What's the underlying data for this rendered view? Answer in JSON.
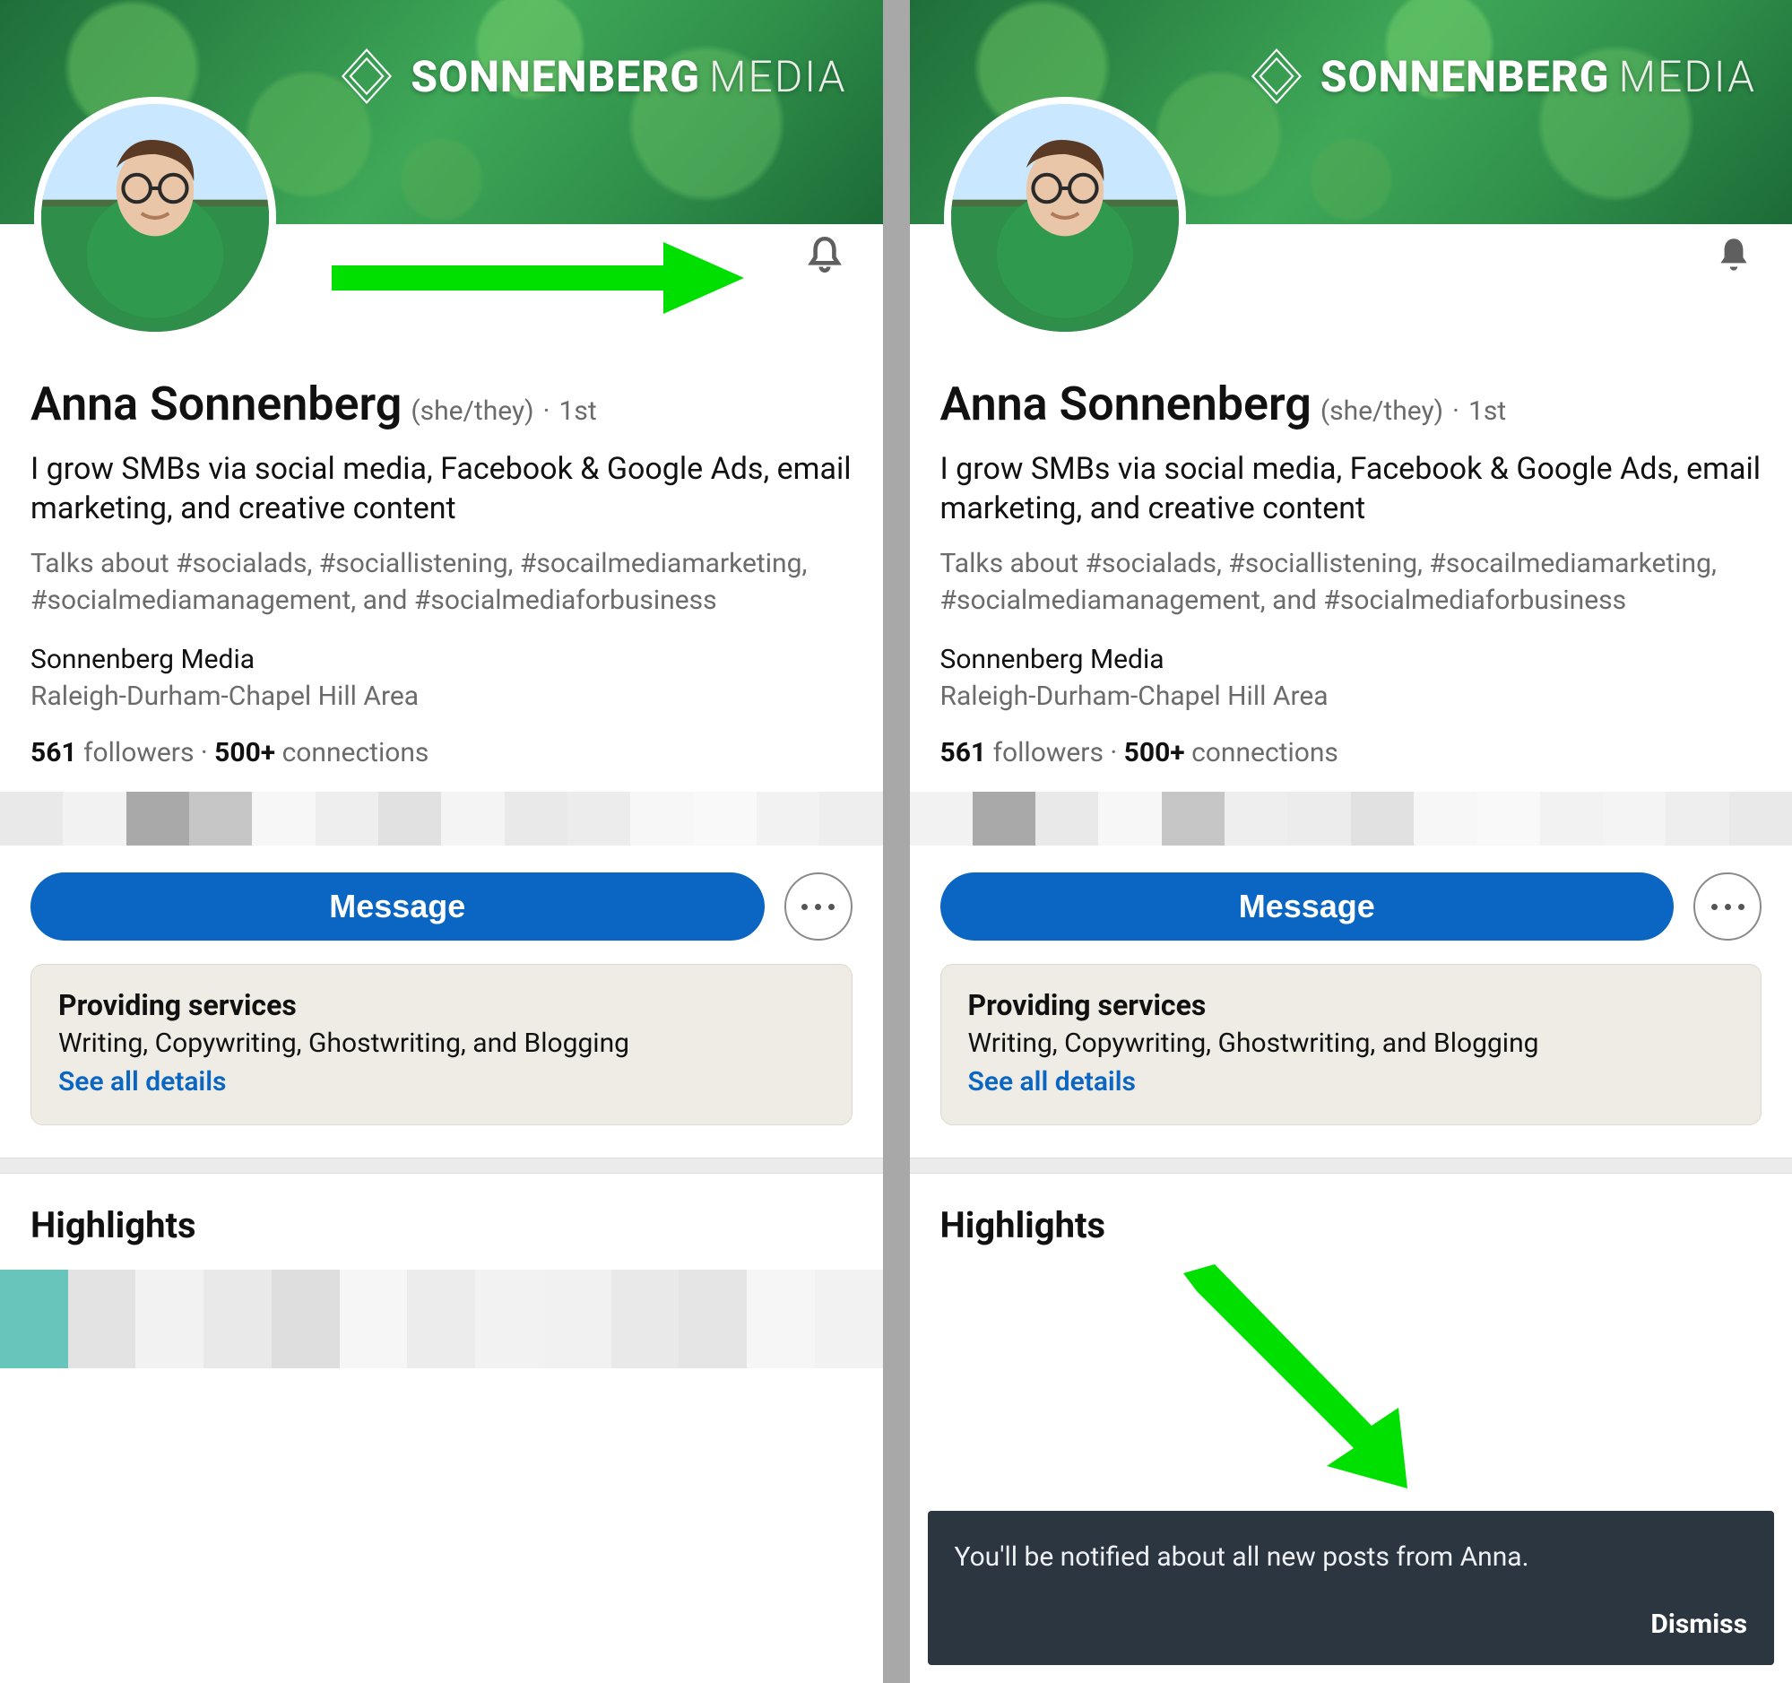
{
  "brand": {
    "strong": "SONNENBERG",
    "light": "MEDIA"
  },
  "profile": {
    "name": "Anna Sonnenberg",
    "pronouns": "(she/they)",
    "degree": "1st",
    "bio": "I grow SMBs via social media, Facebook & Google Ads, email marketing, and creative content",
    "talks": "Talks about #socialads, #sociallistening, #socailmediamarketing, #socialmediamanagement, and #socialmediaforbusiness",
    "company": "Sonnenberg Media",
    "location": "Raleigh-Durham-Chapel Hill Area",
    "followers_count": "561",
    "followers_label": " followers",
    "connections_count": "500+",
    "connections_label": " connections"
  },
  "actions": {
    "message": "Message"
  },
  "services": {
    "heading": "Providing services",
    "list": "Writing, Copywriting, Ghostwriting, and Blogging",
    "link": "See all details"
  },
  "highlights": {
    "heading": "Highlights"
  },
  "toast": {
    "message": "You'll be notified about all new posts from Anna.",
    "dismiss": "Dismiss"
  }
}
